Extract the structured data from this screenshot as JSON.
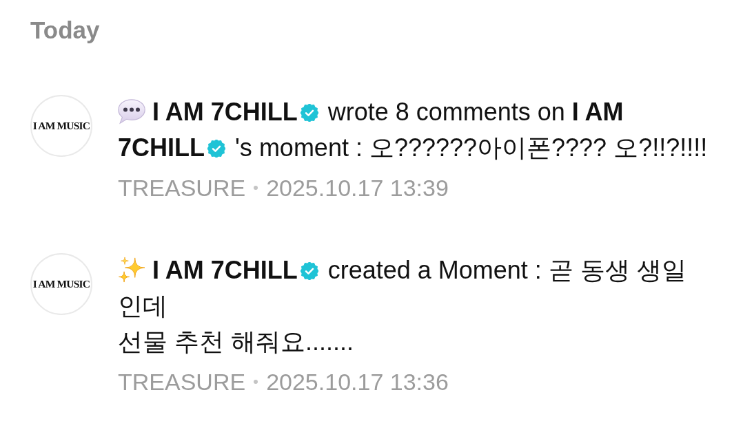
{
  "section_title": "Today",
  "notifications": [
    {
      "kind": "comment",
      "avatar_text": "I AM MUSIC",
      "parts": [
        {
          "kind": "name",
          "text": "I AM 7CHILL",
          "verified": true
        },
        {
          "kind": "text",
          "text": "wrote 8 comments on"
        },
        {
          "kind": "name",
          "text": "I AM 7CHILL",
          "verified": true
        },
        {
          "kind": "text",
          "text": "'s moment : 오??????아이폰???? 오?!!?!!!!"
        }
      ],
      "source": "TREASURE",
      "time": "2025.10.17 13:39"
    },
    {
      "kind": "moment",
      "avatar_text": "I AM MUSIC",
      "parts": [
        {
          "kind": "name",
          "text": "I AM 7CHILL",
          "verified": true
        },
        {
          "kind": "text",
          "text": "created a Moment : 곧 동생 생일인데\n선물 추천 해줘요......."
        }
      ],
      "source": "TREASURE",
      "time": "2025.10.17 13:36"
    }
  ]
}
